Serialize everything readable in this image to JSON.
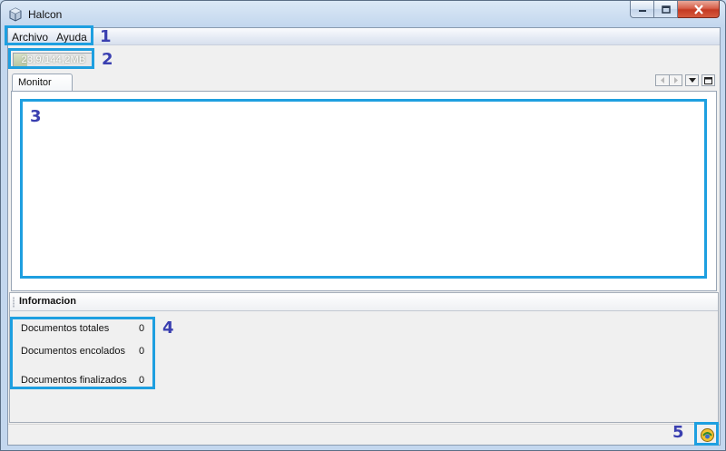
{
  "window": {
    "title": "Halcon",
    "icon": "cube-icon"
  },
  "menu": {
    "items": [
      "Archivo",
      "Ayuda"
    ]
  },
  "memory": {
    "label": "23,9/144,2MB",
    "used_fraction": 0.166
  },
  "tabs": [
    {
      "label": "Monitor"
    }
  ],
  "tab_controls": [
    "scroll-left-icon",
    "scroll-right-icon",
    "dropdown-icon",
    "maximize-panel-icon"
  ],
  "info": {
    "title": "Informacion",
    "rows": [
      {
        "label": "Documentos totales",
        "value": "0"
      },
      {
        "label": "Documentos encolados",
        "value": "0"
      },
      {
        "label": "Documentos finalizados",
        "value": "0"
      }
    ]
  },
  "status": {
    "icon": "halcon-tray-icon"
  },
  "annotations": [
    "1",
    "2",
    "3",
    "4",
    "5"
  ],
  "colors": {
    "annotation_border": "#1e9fe0",
    "annotation_number": "#3a3fb0",
    "close_button": "#c43a22"
  }
}
